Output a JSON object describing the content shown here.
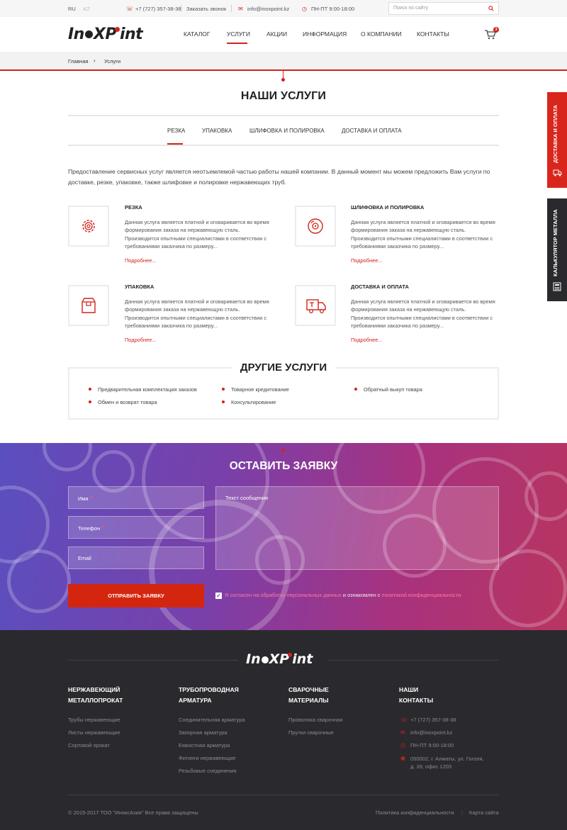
{
  "topbar": {
    "lang_ru": "RU",
    "lang_kz": "KZ",
    "phone": "+7 (727) 357-38-38",
    "callback": "Заказать звонок",
    "email": "info@inoxpoint.kz",
    "hours": "ПН-ПТ  9:00-18:00",
    "search_placeholder": "Поиск по сайту"
  },
  "header": {
    "logo_part1": "In",
    "logo_part2": "XP",
    "logo_part3": "int",
    "nav": [
      "КАТАЛОГ",
      "УСЛУГИ",
      "АКЦИИ",
      "ИНФОРМАЦИЯ",
      "О КОМПАНИИ",
      "КОНТАКТЫ"
    ],
    "active_nav": "УСЛУГИ",
    "cart_count": "3"
  },
  "breadcrumb": {
    "home": "Главная",
    "arrow": "›",
    "current": "Услуги"
  },
  "services": {
    "title": "НАШИ УСЛУГИ",
    "tabs": [
      "РЕЗКА",
      "УПАКОВКА",
      "ШЛИФОВКА И ПОЛИРОВКА",
      "ДОСТАВКА И ОПЛАТА"
    ],
    "active_tab": "РЕЗКА",
    "intro": "Предоставление сервисных услуг является неотъемлемой частью работы нашей компании. В данный момент мы можем предложить Вам услуги по доставке, резке, упаковке, также шлифовке и полировке нержавеющих труб.",
    "cards": [
      {
        "title": "РЕЗКА",
        "icon": "gear-icon",
        "line1": "Данная услуга является платной и оговаривается во время",
        "line2": "формирования заказа на нержавеющую сталь.",
        "line3": "Производится опытными специалистами в соответствии с",
        "line4": "требованиями заказчика по размеру...",
        "more": "Подробнее..."
      },
      {
        "title": "ШЛИФОВКА И ПОЛИРОВКА",
        "icon": "disc-icon",
        "line1": "Данная услуга является платной и оговаривается во время",
        "line2": "формирования заказа на нержавеющую сталь.",
        "line3": "Производится опытными специалистами в соответствии с",
        "line4": "требованиями заказчика по размеру...",
        "more": "Подробнее..."
      },
      {
        "title": "УПАКОВКА",
        "icon": "box-icon",
        "line1": "Данная услуга является платной и оговаривается во время",
        "line2": "формирования заказа на нержавеющую сталь.",
        "line3": "Производится опытными специалистами в соответствии с",
        "line4": "требованиями заказчика по размеру...",
        "more": "Подробнее..."
      },
      {
        "title": "ДОСТАВКА И ОПЛАТА",
        "icon": "truck-icon",
        "line1": "Данная услуга является платной и оговаривается во время",
        "line2": "формирования заказа на нержавеющую сталь.",
        "line3": "Производится опытными специалистами в соответствии с",
        "line4": "требованиями заказчика по размеру...",
        "more": "Подробнее..."
      }
    ]
  },
  "other": {
    "title": "ДРУГИЕ УСЛУГИ",
    "items": [
      "Предварительная комплектация заказов",
      "Обмен и возврат товара",
      "Товарное кредитование",
      "Консультирование",
      "Обратный выкуп товара"
    ]
  },
  "form": {
    "title": "ОСТАВИТЬ ЗАЯВКУ",
    "name": "Имя",
    "phone": "Телефон",
    "email": "Email",
    "required_mark": "*",
    "message": "Текст сообщения",
    "submit": "ОТПРАВИТЬ ЗАЯВКУ",
    "agree_1": "Я согласен на обработку персональных данных",
    "agree_2": " и ознакомлен с ",
    "agree_3": "политикой конфиденциальности",
    "agree_checked": true
  },
  "footer": {
    "col1_title_1": "НЕРЖАВЕЮЩИЙ",
    "col1_title_2": "МЕТАЛЛОПРОКАТ",
    "col1_links": [
      "Трубы нержавеющие",
      "Листы нержавеющие",
      "Сортовой прокат"
    ],
    "col2_title_1": "ТРУБОПРОВОДНАЯ",
    "col2_title_2": "АРМАТУРА",
    "col2_links": [
      "Соединительная арматура",
      "Запорная арматура",
      "Емкостная арматура",
      "Фитинги нержавеющие",
      "Резьбовые соединения"
    ],
    "col3_title_1": "СВАРОЧНЫЕ",
    "col3_title_2": "МАТЕРИАЛЫ",
    "col3_links": [
      "Проволока сварочная",
      "Прутки сварочные"
    ],
    "col4_title_1": "НАШИ",
    "col4_title_2": "КОНТАКТЫ",
    "phone": "+7 (727) 357-38-38",
    "email": "info@inoxpoint.kz",
    "hours": "ПН-ПТ  9:00-18:00",
    "address_1": "050002, г. Алматы, ул. Гоголя,",
    "address_2": "д. 39, офис 1203",
    "copyright": "© 2015-2017 ТОО \"ИноксАзия\" Все права защищены",
    "privacy": "Политика конфиденциальности",
    "sitemap": "Карта сайта"
  },
  "side": {
    "delivery": "ДОСТАВКА И ОПЛАТА",
    "calculator": "КАЛЬКУЛЯТОР МЕТАЛЛА"
  },
  "colors": {
    "accent": "#d2231b",
    "footer_bg": "#2a2a2e",
    "side_red": "#d9261c",
    "side_dark": "#2a2a2e"
  }
}
